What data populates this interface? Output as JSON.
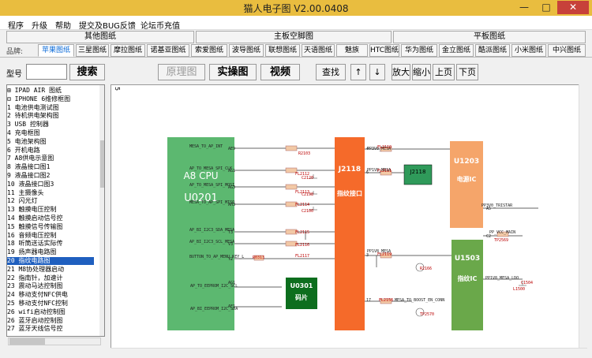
{
  "window": {
    "title": "猫人电子图 V2.00.0408",
    "min": "—",
    "max": "□",
    "close": "✕"
  },
  "menu": [
    "程序",
    "升级",
    "帮助",
    "提交及BUG反馈",
    "论坛币充值"
  ],
  "categories": [
    "其他图纸",
    "主板空脚图",
    "平板图纸"
  ],
  "brand_label": "品牌:",
  "tabs": [
    "苹果图纸",
    "三星图纸",
    "摩拉图纸",
    "诺基亚图纸",
    "索爱图纸",
    "波导图纸",
    "联想图纸",
    "天语图纸",
    "魅族",
    "HTC图纸",
    "华为图纸",
    "金立图纸",
    "酷派图纸",
    "小米图纸",
    "中兴图纸"
  ],
  "search": {
    "label": "型号",
    "value": "",
    "button": "搜索"
  },
  "toolbar": [
    "原理图",
    "实操图",
    "视频",
    "查找",
    "↑",
    "↓",
    "放大",
    "缩小",
    "上页",
    "下页"
  ],
  "tree": [
    "⊞ IPAD AIR 图纸",
    "⊟ IPHONE 6维修框图",
    "  1 电池供电测试图",
    "  2 待机供电架构图",
    "  3 USB 控制器",
    "  4 充电框图",
    "  5 电池架构图",
    "  6 开机电路",
    "  7 A8供电示意图",
    "  8 液晶接口图1",
    "  9 液晶接口图2",
    "  10 液晶接口图3",
    "  11 主摄像头",
    "  12 闪光灯",
    "  13 触摸电压控制",
    "  14 触摸启动信号控",
    "  15 触摸信号传输图",
    "  16 音频电压控制",
    "  18 听筒送话实际传",
    "  19 扬声器电路图",
    "  20 指纹电路图",
    "  21 M8协处理器启动",
    "  22 指南针，加速计",
    "  23 震动马达控制图",
    "  24 移动支付NFC供电",
    "  25 移动支付NFC控制",
    "  26 wifi启动控制图",
    "  26 蓝牙启动控制图",
    "  27 蓝牙天线信号控"
  ],
  "tree_selected": 20,
  "schematic": {
    "cpu": {
      "title": "A8 CPU",
      "ref": "U0201"
    },
    "conn": {
      "title": "J2118",
      "sub": "指纹接口"
    },
    "pmic": {
      "title": "U1203",
      "sub": "电源IC"
    },
    "fp": {
      "title": "U1503",
      "sub": "指纹IC"
    },
    "rom": {
      "title": "U0301",
      "sub": "码片"
    },
    "j2118": "J2118",
    "nets": [
      "MESA_TO_AP_INT",
      "AP_TO_MESA_SPI_CLK",
      "AP_TO_MESA_SPI_MOSI",
      "MESA_TO_AP_SPI_MISO",
      "AP_BI_I2C3_SDA_MESA",
      "AP_BI_I2C3_SCL_MESA",
      "BUTTON_TO_AP_MENU_KEY_L",
      "AP_TO_EEPROM_I2C_SCL",
      "AP_BI_EEPROM_I2C_SDA",
      "PP3V0_MESA",
      "PP1V8_MESA",
      "PP1V8_MESA",
      "MESA_TO_BOOST_EN_CONN",
      "PP_VCC_MAIN",
      "PP3V0_TRISTAR",
      "PP1V8_MESA_LDO"
    ],
    "parts": [
      "R2103",
      "FL2110",
      "FL2111",
      "FL2112",
      "FL2113",
      "FL2114",
      "FL2115",
      "FL2116",
      "FL2117",
      "C2120",
      "C2198",
      "C2100",
      "R0313",
      "FL2119",
      "FL2158",
      "R2166",
      "TP2570",
      "TP2569",
      "L1500",
      "C1504"
    ]
  }
}
